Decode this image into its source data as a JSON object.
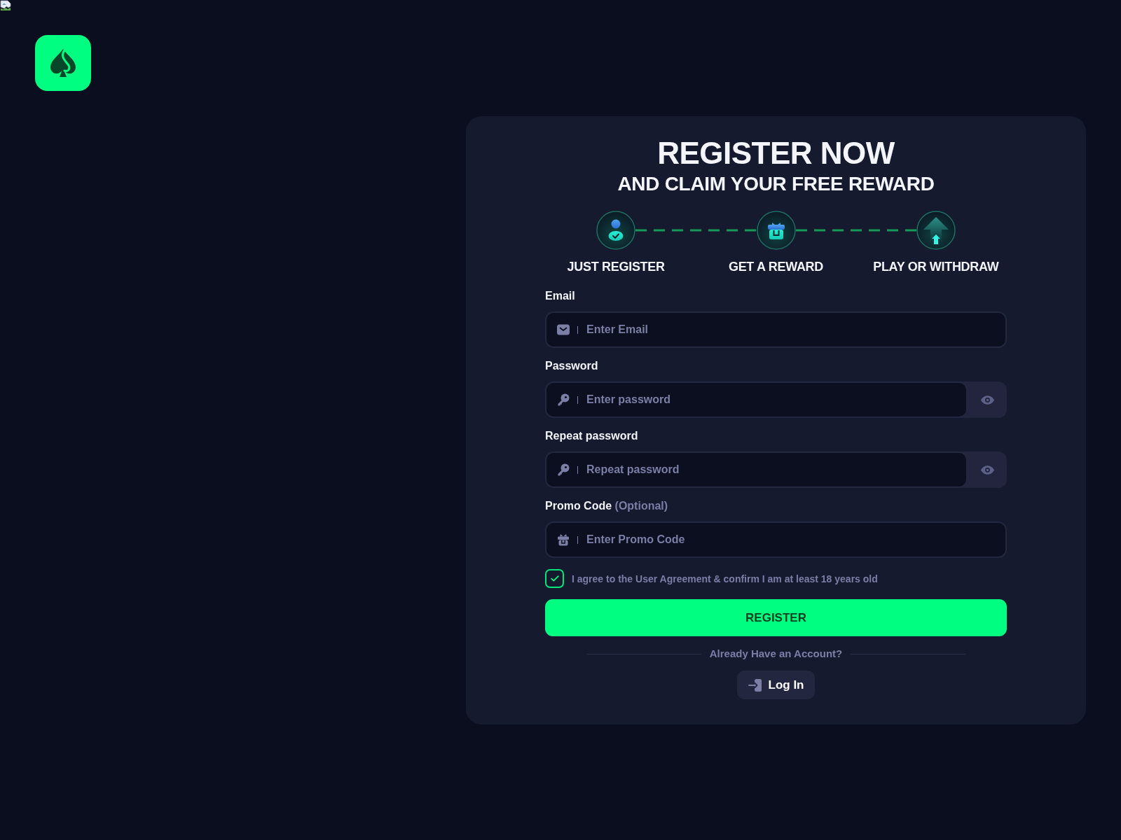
{
  "header": {
    "title": "REGISTER NOW",
    "subtitle": "AND CLAIM YOUR FREE REWARD"
  },
  "steps": [
    {
      "kind": "user",
      "label": "JUST REGISTER"
    },
    {
      "kind": "gift",
      "label": "GET A REWARD"
    },
    {
      "kind": "arrow",
      "label": "PLAY OR WITHDRAW"
    }
  ],
  "fields": [
    {
      "kind": "email",
      "label": "Email",
      "placeholder": "Enter Email"
    },
    {
      "kind": "password",
      "label": "Password",
      "placeholder": "Enter password"
    },
    {
      "kind": "password",
      "label": "Repeat password",
      "placeholder": "Repeat password"
    },
    {
      "kind": "promo",
      "label": "Promo Code",
      "note": "(Optional)",
      "placeholder": "Enter Promo Code"
    }
  ],
  "agreement": {
    "checked": true,
    "text": "I agree to the User Agreement & confirm I am at least 18 years old"
  },
  "register_button": {
    "label": "REGISTER"
  },
  "login": {
    "prompt": "Already Have an Account?",
    "button": "Log In"
  }
}
